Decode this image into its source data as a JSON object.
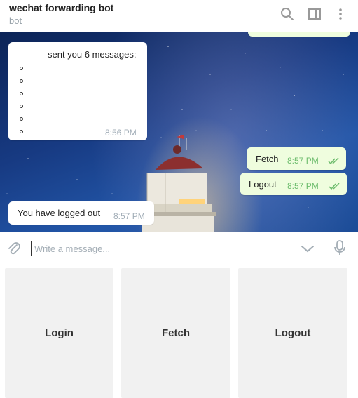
{
  "header": {
    "title": "wechat forwarding bot",
    "subtitle": "bot"
  },
  "messages": {
    "incoming_list": {
      "text": "sent you 6 messages:",
      "list_item_count": 6,
      "time": "8:56 PM"
    },
    "fetch": {
      "text": "Fetch",
      "time": "8:57 PM"
    },
    "logout": {
      "text": "Logout",
      "time": "8:57 PM"
    },
    "logged_out": {
      "text": "You have logged out",
      "time": "8:57 PM"
    }
  },
  "composer": {
    "placeholder": "Write a message..."
  },
  "keyboard": {
    "buttons": [
      {
        "label": "Login"
      },
      {
        "label": "Fetch"
      },
      {
        "label": "Logout"
      }
    ]
  },
  "colors": {
    "outgoing_bubble": "#effdde",
    "read_ticks": "#6cbc6c",
    "keyboard_button": "#f1f1f1"
  }
}
